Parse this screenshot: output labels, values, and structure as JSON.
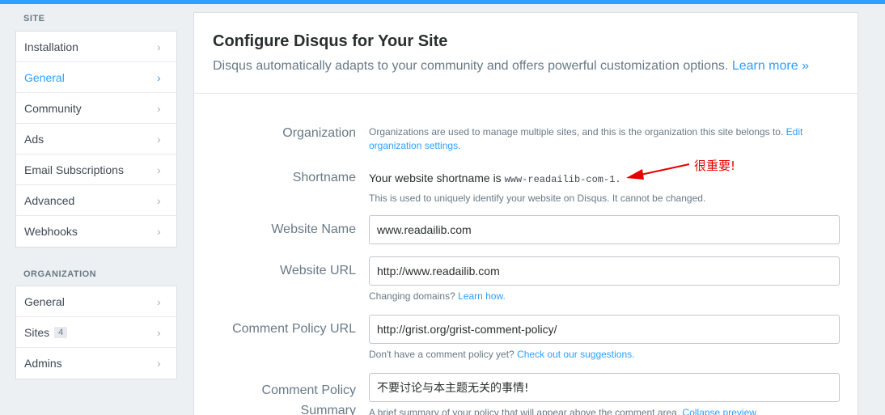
{
  "sidebar": {
    "site_title": "SITE",
    "site_items": [
      {
        "label": "Installation"
      },
      {
        "label": "General"
      },
      {
        "label": "Community"
      },
      {
        "label": "Ads"
      },
      {
        "label": "Email Subscriptions"
      },
      {
        "label": "Advanced"
      },
      {
        "label": "Webhooks"
      }
    ],
    "org_title": "ORGANIZATION",
    "org_items": [
      {
        "label": "General"
      },
      {
        "label": "Sites",
        "badge": "4"
      },
      {
        "label": "Admins"
      }
    ]
  },
  "header": {
    "title": "Configure Disqus for Your Site",
    "subtitle": "Disqus automatically adapts to your community and offers powerful customization options.",
    "learn_more": "Learn more »"
  },
  "form": {
    "organization": {
      "label": "Organization",
      "text": "Organizations are used to manage multiple sites, and this is the organization this site belongs to.",
      "link": "Edit organization settings."
    },
    "shortname": {
      "label": "Shortname",
      "text": "Your website shortname is",
      "value": "www-readailib-com-1.",
      "help": "This is used to uniquely identify your website on Disqus. It cannot be changed."
    },
    "website_name": {
      "label": "Website Name",
      "value": "www.readailib.com"
    },
    "website_url": {
      "label": "Website URL",
      "value": "http://www.readailib.com",
      "help": "Changing domains?",
      "help_link": "Learn how."
    },
    "comment_policy_url": {
      "label": "Comment Policy URL",
      "value": "http://grist.org/grist-comment-policy/",
      "help": "Don't have a comment policy yet?",
      "help_link": "Check out our suggestions."
    },
    "comment_policy_summary": {
      "label_line1": "Comment Policy",
      "label_line2": "Summary",
      "value": "不要讨论与本主题无关的事情!",
      "help": "A brief summary of your policy that will appear above the comment area.",
      "help_link": "Collapse preview."
    }
  },
  "annotation": {
    "text": "很重要!",
    "color": "#e60000"
  },
  "colors": {
    "accent": "#2e9fff",
    "topbar": "#2e9fff",
    "background": "#edf0f2"
  }
}
